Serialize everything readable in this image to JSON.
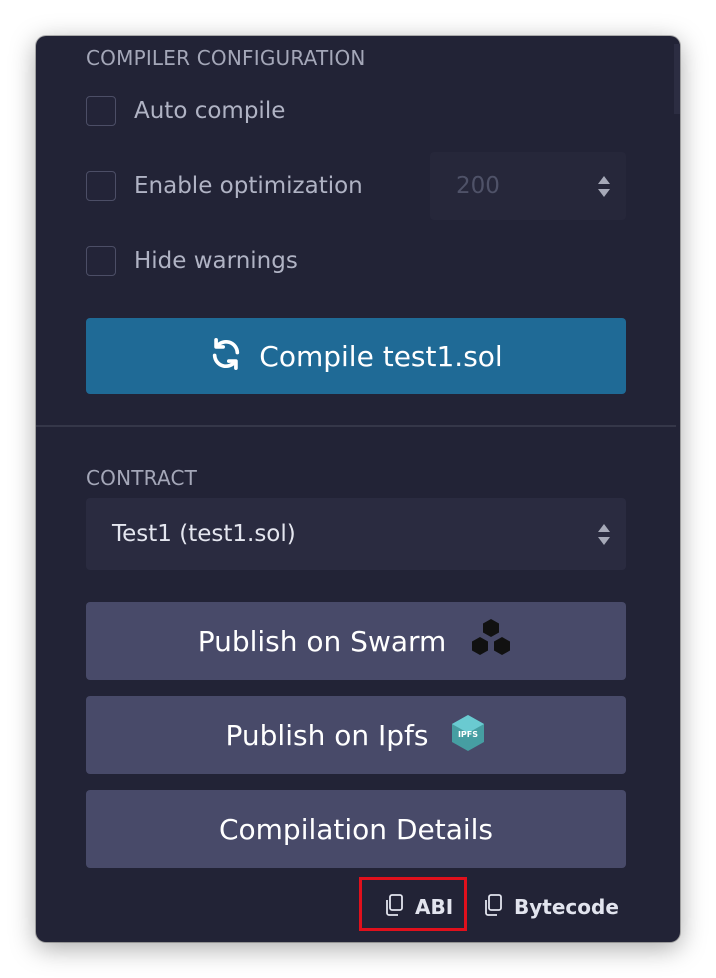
{
  "compiler_config": {
    "title": "COMPILER CONFIGURATION",
    "auto_compile_label": "Auto compile",
    "enable_optimization_label": "Enable optimization",
    "optimization_runs": "200",
    "hide_warnings_label": "Hide warnings",
    "compile_button_label": "Compile test1.sol",
    "compile_icon": "refresh-icon"
  },
  "contract": {
    "title": "CONTRACT",
    "selected": "Test1 (test1.sol)",
    "publish_swarm_label": "Publish on Swarm",
    "swarm_icon": "swarm-icon",
    "publish_ipfs_label": "Publish on Ipfs",
    "ipfs_icon": "ipfs-icon",
    "ipfs_icon_text": "IPFS",
    "compilation_details_label": "Compilation Details",
    "abi_label": "ABI",
    "bytecode_label": "Bytecode",
    "copy_icon": "copy-icon"
  },
  "colors": {
    "panel_bg": "#222336",
    "compile_button": "#1f6a96",
    "action_button": "#484a69",
    "highlight": "#e0101c"
  }
}
